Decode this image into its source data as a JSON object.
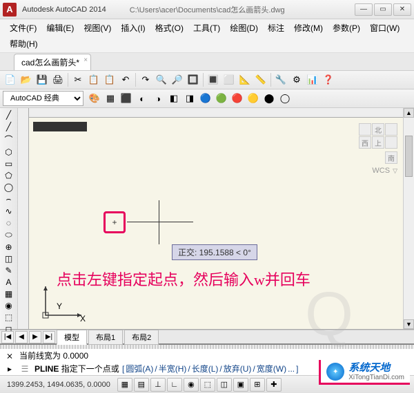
{
  "title": {
    "app": "Autodesk AutoCAD 2014",
    "path": "C:\\Users\\acer\\Documents\\cad怎么画箭头.dwg"
  },
  "menu": [
    {
      "label": "文件(F)"
    },
    {
      "label": "编辑(E)"
    },
    {
      "label": "视图(V)"
    },
    {
      "label": "插入(I)"
    },
    {
      "label": "格式(O)"
    },
    {
      "label": "工具(T)"
    },
    {
      "label": "绘图(D)"
    },
    {
      "label": "标注"
    },
    {
      "label": "修改(M)"
    },
    {
      "label": "参数(P)"
    },
    {
      "label": "窗口(W)"
    },
    {
      "label": "帮助(H)"
    }
  ],
  "file_tab": {
    "label": "cad怎么画箭头*",
    "close": "×"
  },
  "workspace_select": "AutoCAD 经典",
  "toolbar_icons_row1": [
    "📄",
    "📂",
    "💾",
    "🖨",
    "✂",
    "📋",
    "📋",
    "↶",
    "↷",
    "🔍",
    "🔎",
    "🔲",
    "🔳",
    "⬜",
    "📐",
    "📏",
    "🔧",
    "⚙",
    "📊",
    "❓"
  ],
  "toolbar_icons_row2": [
    "🎨",
    "▦",
    "⬛",
    "◐",
    "◑",
    "◧",
    "◨",
    "🔵",
    "🟢",
    "🔴",
    "🟡",
    "⬤",
    "◯"
  ],
  "left_tool_icons": [
    "╱",
    "╱",
    "⌒",
    "⬡",
    "▭",
    "⬠",
    "◯",
    "⌢",
    "∿",
    "◌",
    "⬭",
    "⊕",
    "◫",
    "✎",
    "A",
    "▦",
    "◉",
    "⬚",
    "◻"
  ],
  "nav_cube": {
    "n": "北",
    "w": "西",
    "top": "上",
    "s": "南"
  },
  "wcs_label": "WCS",
  "tooltip": "正交: 195.1588 < 0°",
  "annotation": "点击左键指定起点，然后输入w并回车",
  "ucs": {
    "x": "X",
    "y": "Y"
  },
  "model_tabs": {
    "nav": [
      "|◀",
      "◀",
      "▶",
      "▶|"
    ],
    "tabs": [
      {
        "label": "模型",
        "active": true
      },
      {
        "label": "布局1",
        "active": false
      },
      {
        "label": "布局2",
        "active": false
      }
    ]
  },
  "cmd": {
    "line1": "当前线宽为  0.0000",
    "prompt_icon": "⨯",
    "prompt_prefix": "▸",
    "prompt_cmd": "PLINE",
    "prompt_text": "指定下一个点或",
    "opts": [
      "[",
      "圆弧(A)",
      "/",
      "半宽(H)",
      "/",
      "长度(L)",
      "/",
      "放弃(U)",
      "/",
      "宽度(W)",
      "...",
      "]"
    ]
  },
  "status": {
    "coords": "1399.2453, 1494.0635, 0.0000",
    "btns": [
      "▦",
      "▤",
      "⊥",
      "∟",
      "◉",
      "⬚",
      "◫",
      "▣",
      "⊞",
      "✚"
    ]
  },
  "watermark": {
    "cn": "系统天地",
    "en": "XiTongTianDi.com"
  }
}
